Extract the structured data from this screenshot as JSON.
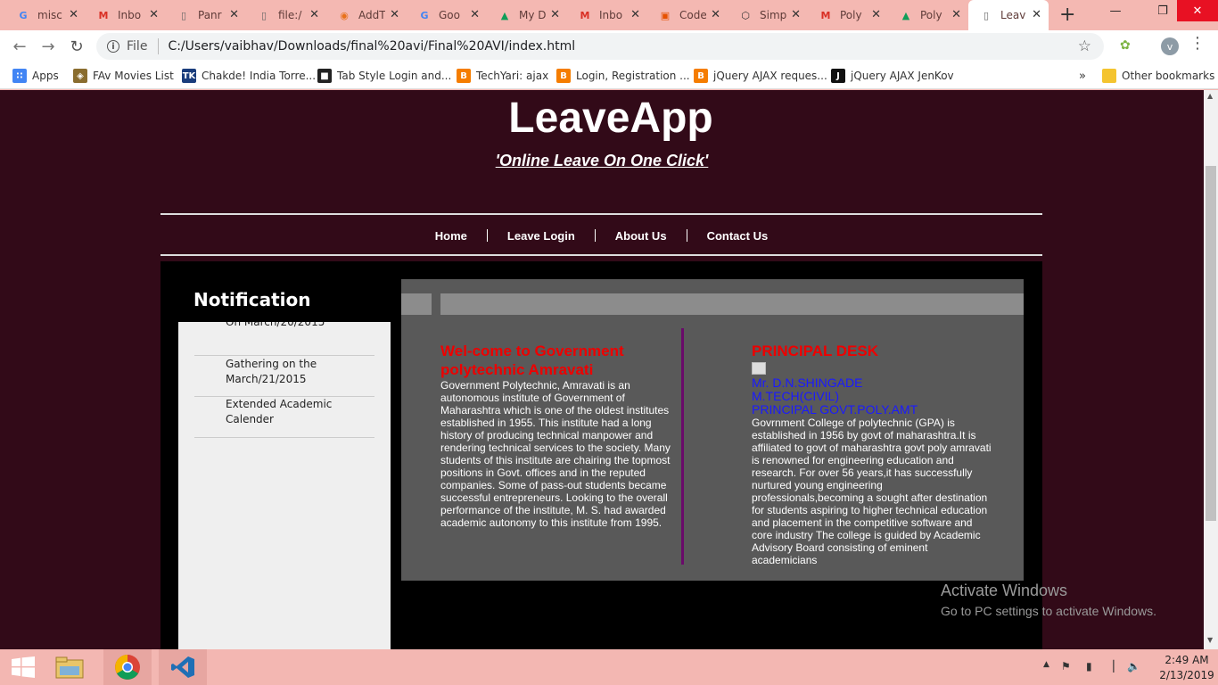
{
  "browser": {
    "tabs": [
      {
        "label": "misc",
        "icon": "google-icon"
      },
      {
        "label": "Inbo",
        "icon": "gmail-icon"
      },
      {
        "label": "Panr",
        "icon": "page-icon"
      },
      {
        "label": "file:/",
        "icon": "page-icon"
      },
      {
        "label": "AddT",
        "icon": "chrome-color-icon"
      },
      {
        "label": "Goo",
        "icon": "google-icon"
      },
      {
        "label": "My D",
        "icon": "drive-icon"
      },
      {
        "label": "Inbo",
        "icon": "gmail-icon"
      },
      {
        "label": "Code",
        "icon": "code-icon"
      },
      {
        "label": "Simp",
        "icon": "codepen-icon"
      },
      {
        "label": "Poly",
        "icon": "gmail-icon"
      },
      {
        "label": "Poly",
        "icon": "drive-icon"
      },
      {
        "label": "Leav",
        "icon": "page-icon"
      }
    ],
    "file_label": "File",
    "url": "C:/Users/vaibhav/Downloads/final%20avi/Final%20AVI/index.html",
    "avatar_letter": "v",
    "bookmarks": [
      {
        "label": "Apps",
        "icon": "apps-grid-icon"
      },
      {
        "label": "FAv Movies List",
        "icon": "shield-icon"
      },
      {
        "label": "Chakde! India Torre...",
        "icon": "tk-icon"
      },
      {
        "label": "Tab Style Login and...",
        "icon": "bookmark-icon"
      },
      {
        "label": "TechYari: ajax",
        "icon": "blogger-icon"
      },
      {
        "label": "Login, Registration ...",
        "icon": "blogger-icon"
      },
      {
        "label": "jQuery AJAX reques...",
        "icon": "blogger-icon"
      },
      {
        "label": "jQuery AJAX JenKov",
        "icon": "j-icon"
      }
    ],
    "more_bookmarks": "»",
    "other_bookmarks": "Other bookmarks"
  },
  "site": {
    "title": "LeaveApp",
    "tagline": "'Online Leave On One Click'",
    "nav": [
      "Home",
      "Leave Login",
      "About Us",
      "Contact Us"
    ],
    "notification_title": "Notification",
    "notifications": [
      "On March/20/2015",
      "Gathering on the March/21/2015",
      "Extended Academic Calender"
    ],
    "welcome": {
      "heading": "Wel-come to Government polytechnic Amravati",
      "body": "Government Polytechnic, Amravati is an autonomous institute of Government of Maharashtra which is one of the oldest institutes established in 1955. This institute had a long history of producing technical manpower and rendering technical services to the society. Many students of this institute are chairing the topmost positions in Govt. offices and in the reputed companies. Some of pass-out students became successful entrepreneurs. Looking to the overall performance of the institute, M. S. had awarded academic autonomy to this institute from 1995."
    },
    "principal": {
      "heading": "PRINCIPAL DESK",
      "name": "Mr. D.N.SHINGADE",
      "degree": "M.TECH(CIVIL)",
      "designation": "PRINCIPAL GOVT.POLY.AMT",
      "body": "Govrnment College of polytechnic (GPA) is established in 1956 by govt of maharashtra.It is affiliated to govt of maharashtra govt poly amravati is renowned for engineering education and research. For over 56 years,it has successfully nurtured young engineering professionals,becoming a sought after destination for students aspiring to higher technical education and placement in the competitive software and core industry The college is guided by Academic Advisory Board consisting of eminent academicians"
    }
  },
  "watermark": {
    "line1": "Activate Windows",
    "line2": "Go to PC settings to activate Windows."
  },
  "taskbar": {
    "time": "2:49 AM",
    "date": "2/13/2019"
  }
}
